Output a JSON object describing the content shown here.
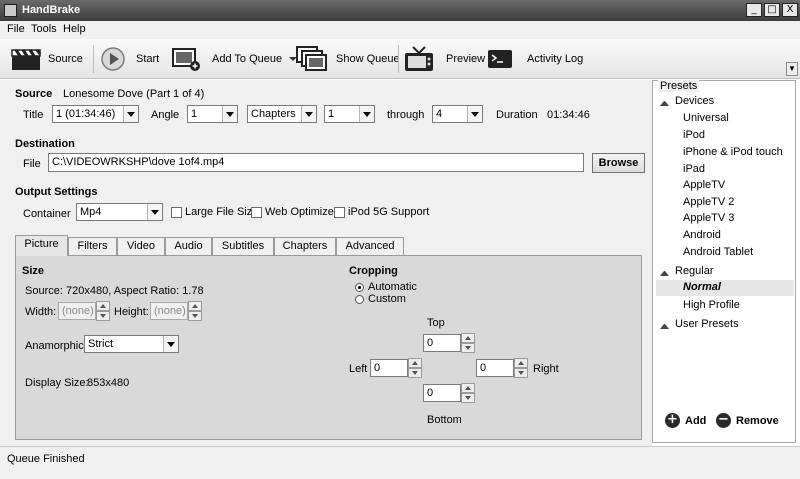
{
  "window": {
    "title": "HandBrake",
    "min": "_",
    "max": "□",
    "close": "X"
  },
  "menu": [
    "File",
    "Tools",
    "Help"
  ],
  "toolbar": {
    "source": "Source",
    "start": "Start",
    "add_to_queue": "Add To Queue",
    "show_queue": "Show Queue",
    "preview": "Preview",
    "activity_log": "Activity Log"
  },
  "source": {
    "heading": "Source",
    "name": "Lonesome Dove (Part 1 of 4)",
    "title_label": "Title",
    "title_value": "1 (01:34:46)",
    "angle_label": "Angle",
    "angle_value": "1",
    "range_type": "Chapters",
    "range_from": "1",
    "through_label": "through",
    "range_to": "4",
    "duration_label": "Duration",
    "duration_value": "01:34:46"
  },
  "destination": {
    "heading": "Destination",
    "file_label": "File",
    "file_value": "C:\\VIDEOWRKSHP\\dove 1of4.mp4",
    "browse": "Browse"
  },
  "output": {
    "heading": "Output Settings",
    "container_label": "Container",
    "container_value": "Mp4",
    "large_file": "Large File Size",
    "web_optimized": "Web Optimized",
    "ipod": "iPod 5G Support"
  },
  "tabs": [
    "Picture",
    "Filters",
    "Video",
    "Audio",
    "Subtitles",
    "Chapters",
    "Advanced"
  ],
  "picture": {
    "size_heading": "Size",
    "source_label": "Source:",
    "source_value": "720x480, Aspect Ratio: 1.78",
    "width_label": "Width:",
    "width_value": "(none)",
    "height_label": "Height:",
    "height_value": "(none)",
    "anamorphic_label": "Anamorphic:",
    "anamorphic_value": "Strict",
    "display_label": "Display Size:",
    "display_value": "853x480",
    "cropping_heading": "Cropping",
    "automatic": "Automatic",
    "custom": "Custom",
    "top_label": "Top",
    "top_value": "0",
    "left_label": "Left",
    "left_value": "0",
    "right_label": "Right",
    "right_value": "0",
    "bottom_label": "Bottom",
    "bottom_value": "0"
  },
  "presets": {
    "legend": "Presets",
    "devices_label": "Devices",
    "devices": [
      "Universal",
      "iPod",
      "iPhone & iPod touch",
      "iPad",
      "AppleTV",
      "AppleTV 2",
      "AppleTV 3",
      "Android",
      "Android Tablet"
    ],
    "regular_label": "Regular",
    "regular": [
      "Normal",
      "High Profile"
    ],
    "user_label": "User Presets",
    "add": "Add",
    "remove": "Remove"
  },
  "status": "Queue Finished"
}
